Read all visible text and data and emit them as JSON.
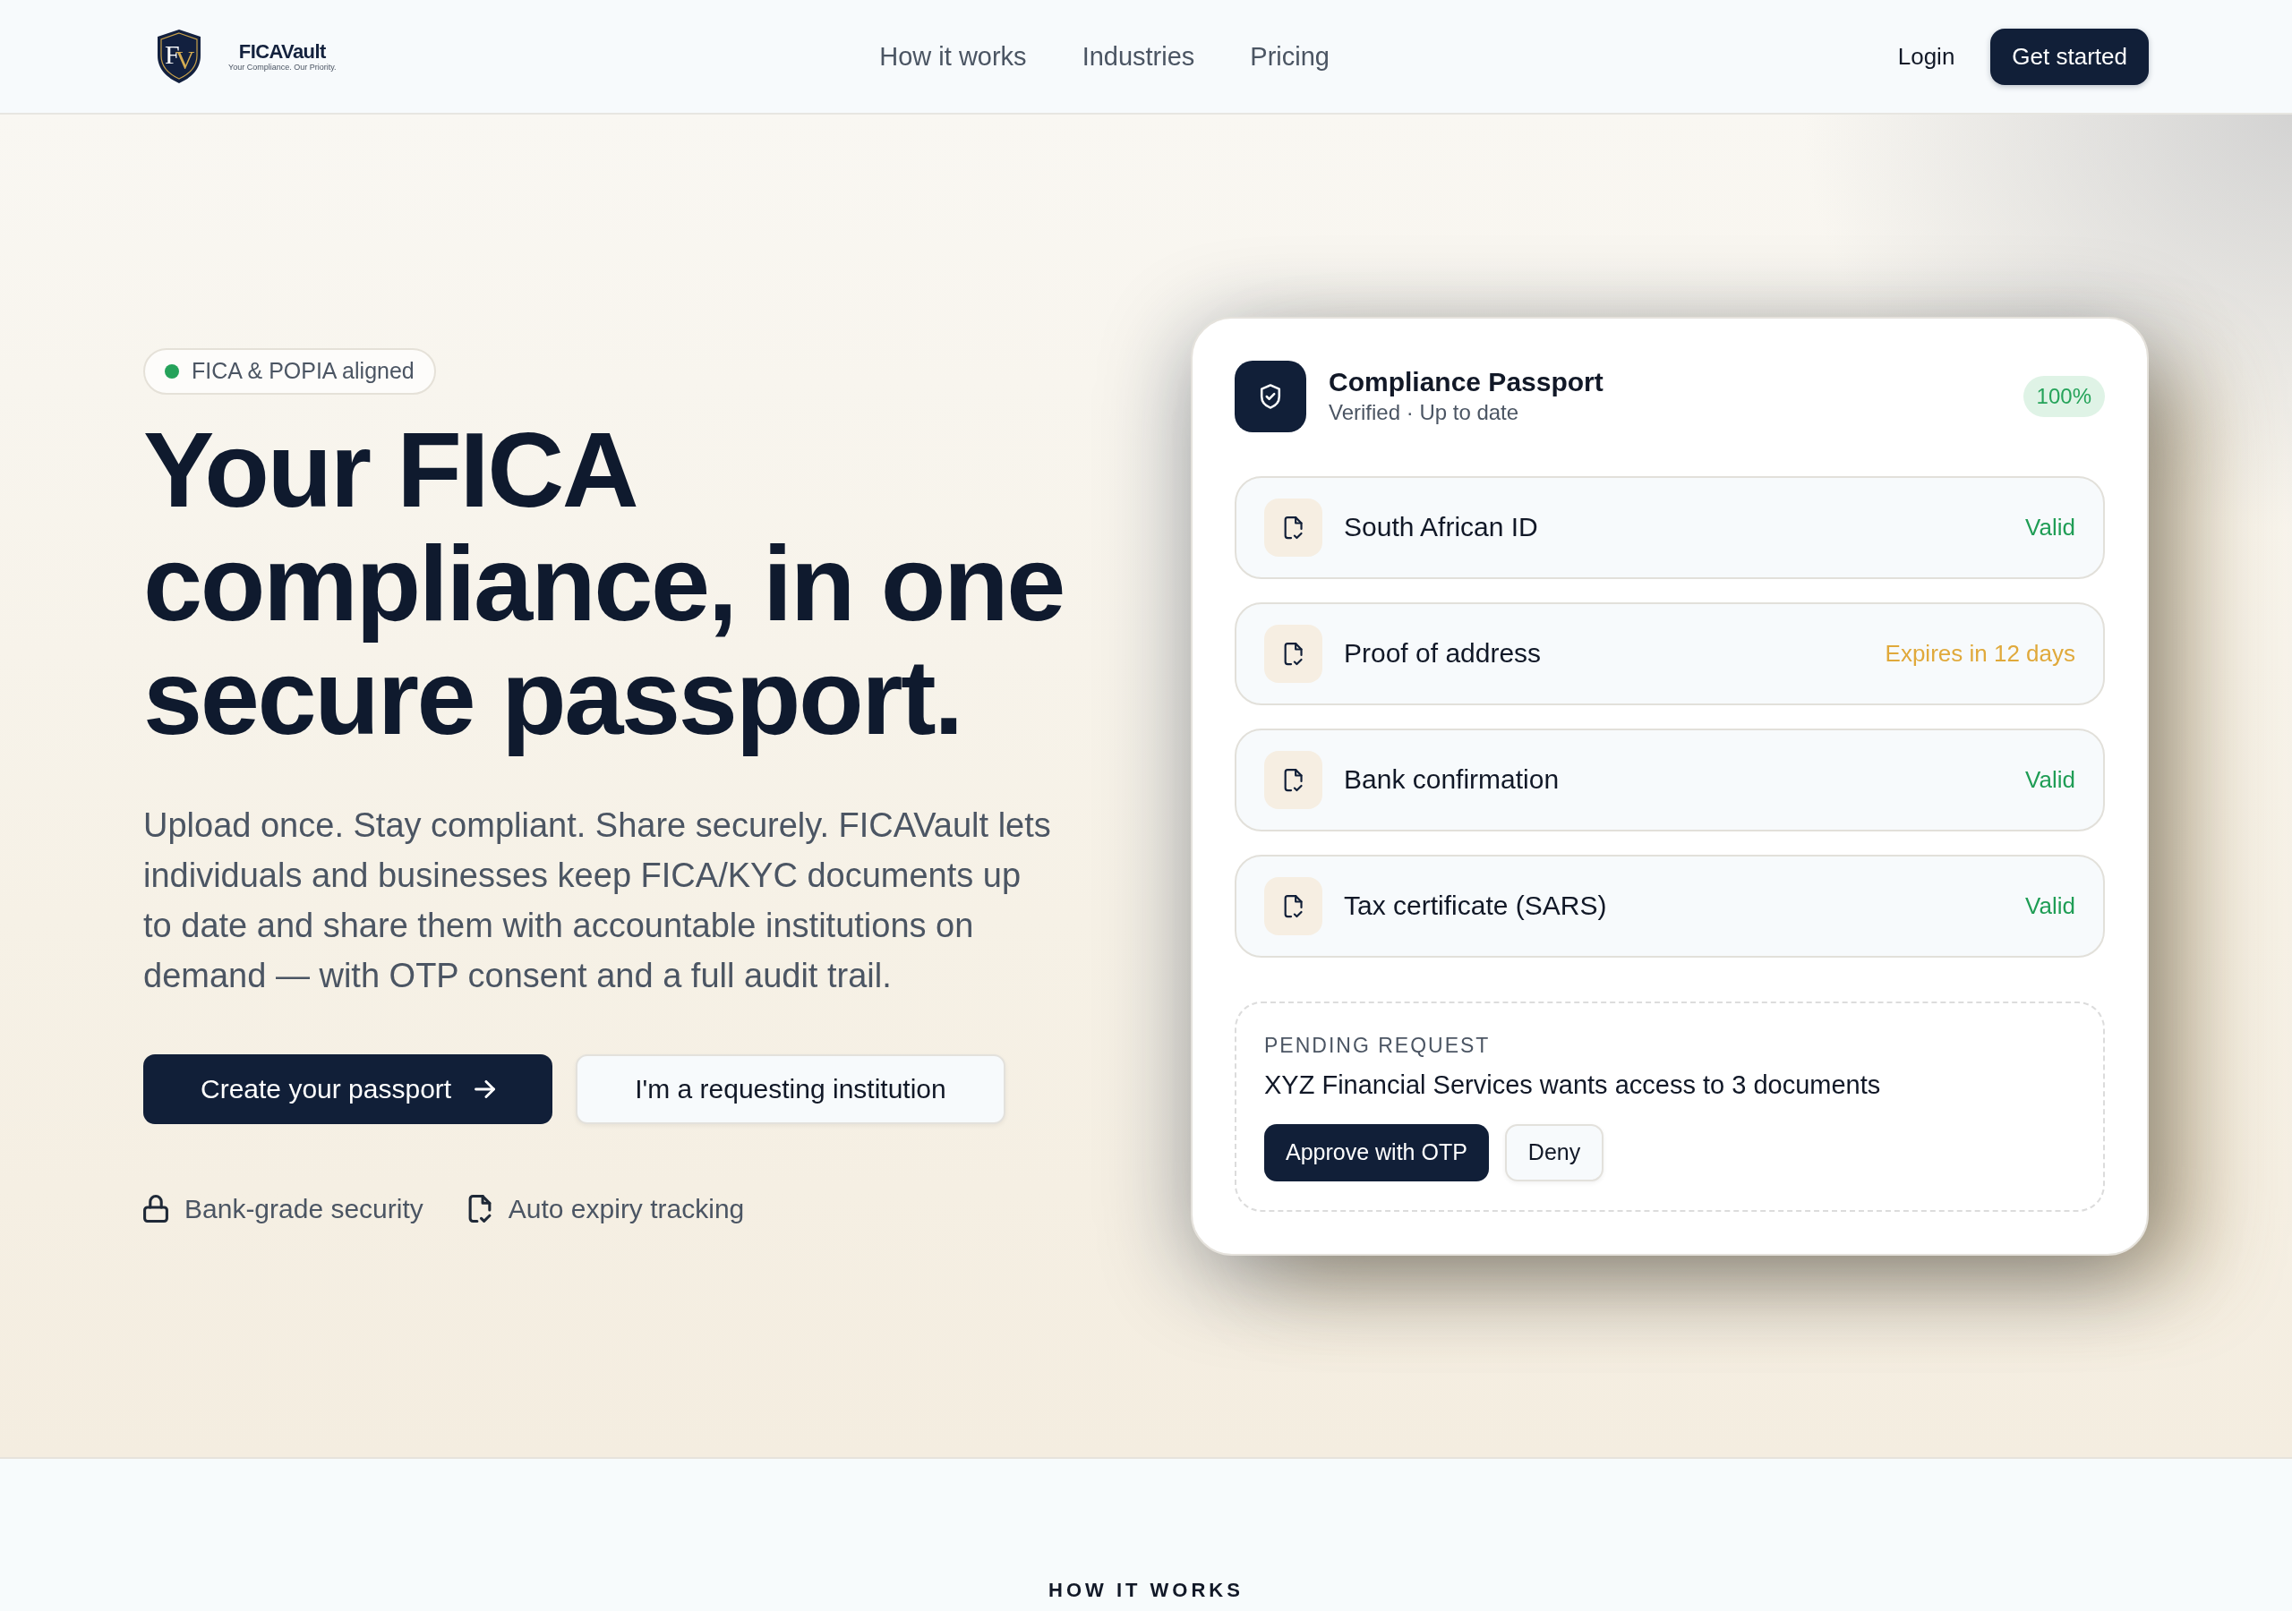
{
  "header": {
    "logo": {
      "monogram": "FV",
      "wordmark": "FICAVault",
      "tagline": "Your Compliance. Our Priority."
    },
    "nav": [
      "How it works",
      "Industries",
      "Pricing"
    ],
    "login": "Login",
    "cta": "Get started"
  },
  "hero": {
    "badge": "FICA & POPIA aligned",
    "headline": "Your FICA compliance, in one secure passport.",
    "description": "Upload once. Stay compliant. Share securely. FICAVault lets individuals and businesses keep FICA/KYC documents up to date and share them with accountable institutions on demand — with OTP consent and a full audit trail.",
    "buttons": [
      {
        "label": "Create your passport",
        "kind": "primary"
      },
      {
        "label": "I'm a requesting institution",
        "kind": "secondary"
      }
    ],
    "features": [
      {
        "label": "Bank-grade security",
        "kind": "security"
      },
      {
        "label": "Auto expiry tracking",
        "kind": "expiry"
      }
    ]
  },
  "passport_card": {
    "title": "Compliance Passport",
    "subtitle": "Verified · Up to date",
    "score": "100%",
    "documents": [
      {
        "name": "South African ID",
        "status": "Valid",
        "expiring": false
      },
      {
        "name": "Proof of address",
        "status": "Expires in 12 days",
        "expiring": true
      },
      {
        "name": "Bank confirmation",
        "status": "Valid",
        "expiring": false
      },
      {
        "name": "Tax certificate (SARS)",
        "status": "Valid",
        "expiring": false
      }
    ],
    "request": {
      "label": "PENDING REQUEST",
      "message": "XYZ Financial Services wants access to 3 documents",
      "actions": [
        {
          "label": "Approve with OTP",
          "kind": "primary"
        },
        {
          "label": "Deny",
          "kind": "secondary"
        }
      ]
    }
  },
  "how_it_works": {
    "eyebrow": "HOW IT WORKS"
  }
}
